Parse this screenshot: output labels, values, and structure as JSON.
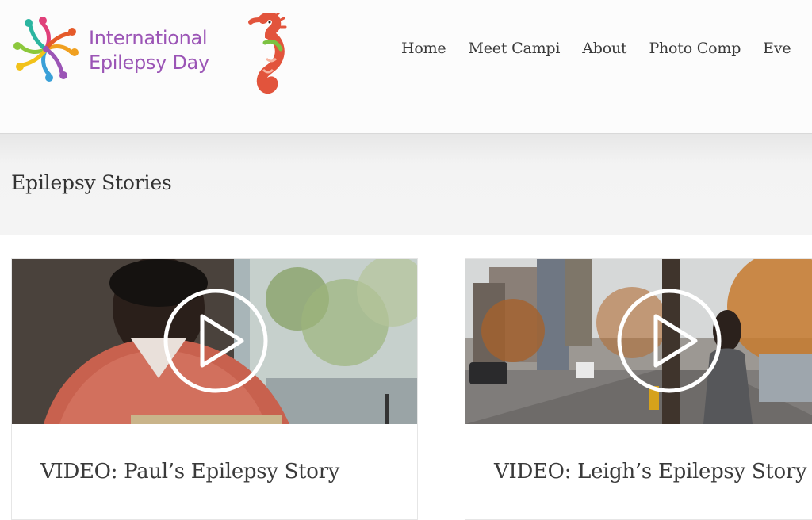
{
  "brand": {
    "name_line1": "International",
    "name_line2": "Epilepsy Day",
    "accent_color": "#9b55b6"
  },
  "nav": {
    "items": [
      "Home",
      "Meet Campi",
      "About",
      "Photo Comp",
      "Eve"
    ]
  },
  "page": {
    "title": "Epilepsy Stories"
  },
  "stories": [
    {
      "title": "VIDEO: Paul’s Epilepsy Story",
      "icon": "play-icon"
    },
    {
      "title": "VIDEO: Leigh’s Epilepsy Story",
      "icon": "play-icon"
    }
  ]
}
